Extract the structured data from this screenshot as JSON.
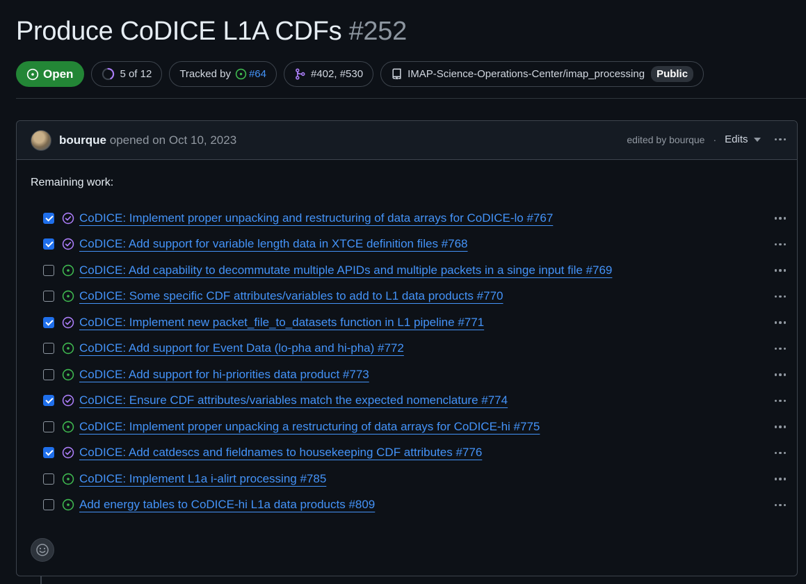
{
  "issue": {
    "title": "Produce CoDICE L1A CDFs",
    "number": "#252",
    "state": "Open",
    "progress": {
      "label": "5 of 12",
      "done": 5,
      "total": 12
    },
    "tracked_by_label": "Tracked by",
    "tracked_by_link": "#64",
    "linked_prs": "#402, #530",
    "repository": "IMAP-Science-Operations-Center/imap_processing",
    "visibility": "Public"
  },
  "comment": {
    "author": "bourque",
    "opened_text": "opened on Oct 10, 2023",
    "edited_text": "edited by bourque",
    "separator": "·",
    "edits_label": "Edits",
    "body_heading": "Remaining work:",
    "tasks": [
      {
        "text": "CoDICE: Implement proper unpacking and restructuring of data arrays for CoDICE-lo #767",
        "checked": true,
        "status": "closed"
      },
      {
        "text": "CoDICE: Add support for variable length data in XTCE definition files #768",
        "checked": true,
        "status": "closed"
      },
      {
        "text": "CoDICE: Add capability to decommutate multiple APIDs and multiple packets in a singe input file #769",
        "checked": false,
        "status": "open"
      },
      {
        "text": "CoDICE: Some specific CDF attributes/variables to add to L1 data products #770",
        "checked": false,
        "status": "open"
      },
      {
        "text": "CoDICE: Implement new packet_file_to_datasets function in L1 pipeline #771",
        "checked": true,
        "status": "closed"
      },
      {
        "text": "CoDICE: Add support for Event Data (lo-pha and hi-pha) #772",
        "checked": false,
        "status": "open"
      },
      {
        "text": "CoDICE: Add support for hi-priorities data product #773",
        "checked": false,
        "status": "open"
      },
      {
        "text": "CoDICE: Ensure CDF attributes/variables match the expected nomenclature #774",
        "checked": true,
        "status": "closed"
      },
      {
        "text": "CoDICE: Implement proper unpacking a restructuring of data arrays for CoDICE-hi #775",
        "checked": false,
        "status": "open"
      },
      {
        "text": "CoDICE: Add catdescs and fieldnames to housekeeping CDF attributes #776",
        "checked": true,
        "status": "closed"
      },
      {
        "text": "CoDICE: Implement L1a i-alirt processing #785",
        "checked": false,
        "status": "open"
      },
      {
        "text": "Add energy tables to CoDICE-hi L1a data products #809",
        "checked": false,
        "status": "open"
      }
    ]
  },
  "colors": {
    "background": "#0d1117",
    "open_green": "#238636",
    "open_icon_green": "#3fb950",
    "closed_purple": "#ab7df8",
    "link_blue": "#4493f8"
  },
  "icons": [
    "issue-opened-icon",
    "progress-ring-icon",
    "git-merge-icon",
    "repo-icon",
    "chevron-down-icon",
    "kebab-icon",
    "smiley-icon",
    "check-circle-icon"
  ]
}
